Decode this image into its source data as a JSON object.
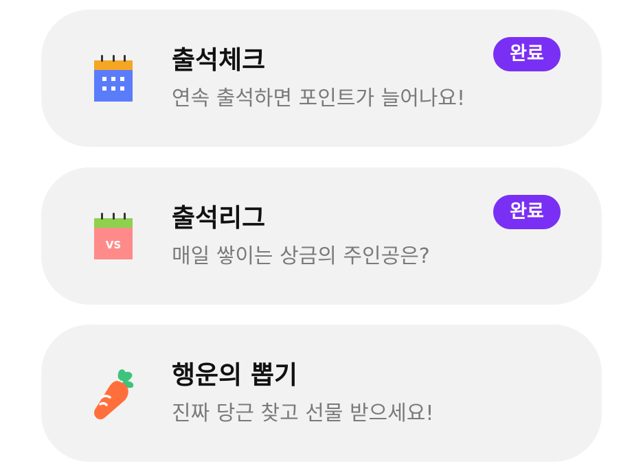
{
  "items": [
    {
      "icon": "calendar-icon",
      "title": "출석체크",
      "subtitle": "연속 출석하면 포인트가 늘어나요!",
      "badge": "완료"
    },
    {
      "icon": "calendar-vs-icon",
      "title": "출석리그",
      "subtitle": "매일 쌓이는 상금의 주인공은?",
      "badge": "완료"
    },
    {
      "icon": "carrot-icon",
      "title": "행운의 뽑기",
      "subtitle": "진짜 당근 찾고 선물 받으세요!"
    }
  ],
  "colors": {
    "card_background": "#f2f2f2",
    "badge_background": "#7a2ff5",
    "title": "#111111",
    "subtitle": "#7a7a7a",
    "calendar_top": "#f5a623",
    "calendar_body": "#5b7cfa",
    "league_top": "#8fd14f",
    "league_body": "#ff8a8a",
    "carrot_body": "#ff6f3c",
    "carrot_leaf": "#3cc47c"
  }
}
